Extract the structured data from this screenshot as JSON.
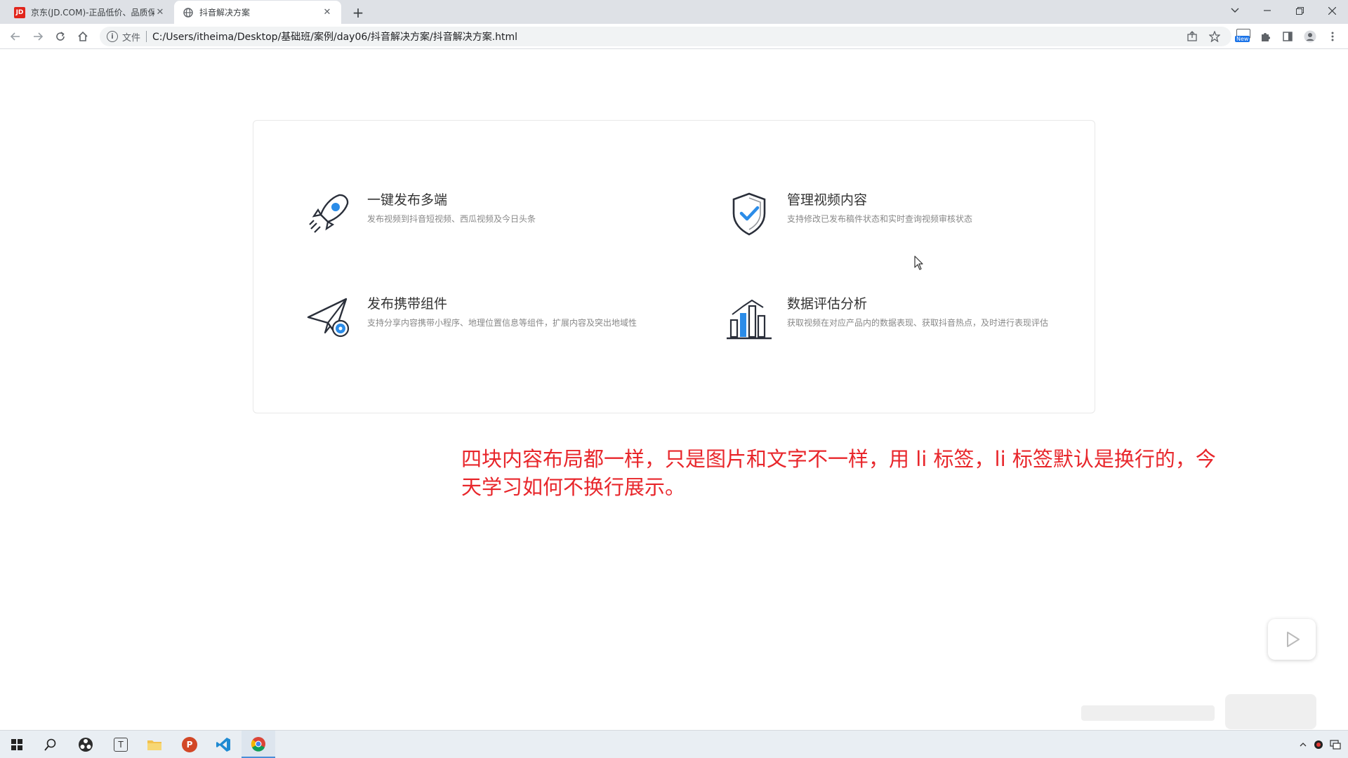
{
  "tabs": [
    {
      "title": "京东(JD.COM)-正品低价、品质保障",
      "favicon": "JD",
      "close": "✕"
    },
    {
      "title": "抖音解决方案",
      "favicon": "globe-icon",
      "close": "✕"
    }
  ],
  "new_tab": "+",
  "address_bar": {
    "scheme": "文件",
    "url": "C:/Users/itheima/Desktop/基础班/案例/day06/抖音解决方案/抖音解决方案.html"
  },
  "extension_badge": "New",
  "features": [
    {
      "title": "一键发布多端",
      "desc": "发布视频到抖音短视频、西瓜视频及今日头条",
      "icon": "rocket-icon"
    },
    {
      "title": "管理视频内容",
      "desc": "支持修改已发布稿件状态和实时查询视频审核状态",
      "icon": "shield-check-icon"
    },
    {
      "title": "发布携带组件",
      "desc": "支持分享内容携带小程序、地理位置信息等组件，扩展内容及突出地域性",
      "icon": "paper-plane-icon"
    },
    {
      "title": "数据评估分析",
      "desc": "获取视频在对应产品内的数据表现、获取抖音热点，及时进行表现评估",
      "icon": "bar-chart-icon"
    }
  ],
  "annotation": "四块内容布局都一样，只是图片和文字不一样，用 li 标签，li 标签默认是换行的，今天学习如何不换行展示。",
  "colors": {
    "accent_blue": "#2b8ce8",
    "note_red": "#e8262b"
  }
}
